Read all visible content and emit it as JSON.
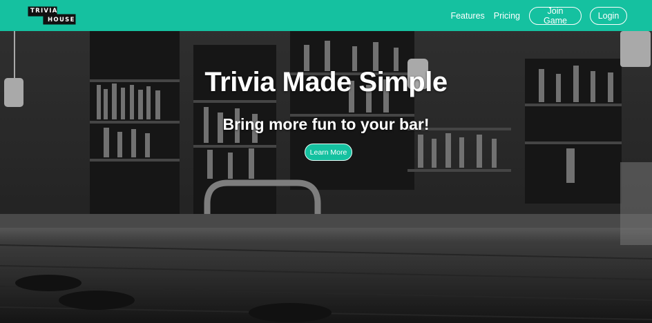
{
  "brand": {
    "logo_line1": "TRIVIA",
    "logo_line2": "HOUSE",
    "color": "#15c1a0"
  },
  "nav": {
    "features": "Features",
    "pricing": "Pricing",
    "join_game": "Join Game",
    "login": "Login"
  },
  "hero": {
    "title": "Trivia Made Simple",
    "subtitle": "Bring more fun to your bar!",
    "cta_label": "Learn More",
    "background": "bar-interior-photo"
  }
}
